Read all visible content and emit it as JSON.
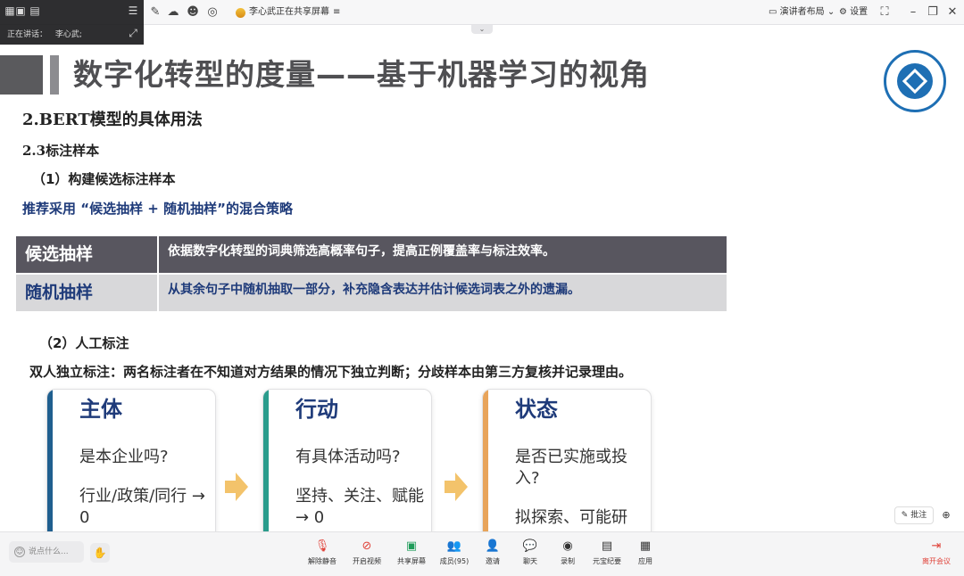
{
  "topbar": {
    "share_text": "李心武正在共享屏幕",
    "layout_label": "演讲者布局",
    "settings_label": "设置"
  },
  "speaker": {
    "label": "正在讲话：",
    "name": "李心武;"
  },
  "slide": {
    "title": "数字化转型的度量——基于机器学习的视角",
    "section": "2.BERT模型的具体用法",
    "subsection": "2.3标注样本",
    "step1": "（1）构建候选标注样本",
    "strategy": "推荐采用 “候选抽样 + 随机抽样”的混合策略",
    "sampling": [
      {
        "name": "候选抽样",
        "desc": "依据数字化转型的词典筛选高概率句子，提高正例覆盖率与标注效率。"
      },
      {
        "name": "随机抽样",
        "desc": "从其余句子中随机抽取一部分，补充隐含表达并估计候选词表之外的遗漏。"
      }
    ],
    "step2": "（2）人工标注",
    "dual": "双人独立标注：两名标注者在不知道对方结果的情况下独立判断；分歧样本由第三方复核并记录理由。",
    "cards": [
      {
        "title": "主体",
        "question": "是本企业吗?",
        "note": "行业/政策/同行 → 0",
        "accent": "#1f5f8f"
      },
      {
        "title": "行动",
        "question": "有具体活动吗?",
        "note": "坚持、关注、赋能 → 0",
        "accent": "#2a9c8c"
      },
      {
        "title": "状态",
        "question": "是否已实施或投入?",
        "note": "拟探索、可能研",
        "accent": "#e8a45a"
      }
    ]
  },
  "chat": {
    "placeholder": "说点什么..."
  },
  "toolbar": [
    {
      "id": "unmute",
      "label": "解除静音",
      "icon": "mic-off-icon"
    },
    {
      "id": "video",
      "label": "开启视频",
      "icon": "video-off-icon"
    },
    {
      "id": "share",
      "label": "共享屏幕",
      "icon": "screen-share-icon"
    },
    {
      "id": "members",
      "label": "成员(95)",
      "icon": "members-icon"
    },
    {
      "id": "invite",
      "label": "邀请",
      "icon": "invite-icon"
    },
    {
      "id": "chat",
      "label": "聊天",
      "icon": "chat-icon"
    },
    {
      "id": "record",
      "label": "录制",
      "icon": "record-icon"
    },
    {
      "id": "summary",
      "label": "元宝纪要",
      "icon": "summary-icon"
    },
    {
      "id": "apps",
      "label": "应用",
      "icon": "apps-icon"
    }
  ],
  "leave_label": "离开会议",
  "annotate_label": "批注",
  "colors": {
    "accent_blue": "#1f3b7a",
    "bar_gray": "#58565f",
    "arrow": "#f3c36b"
  }
}
